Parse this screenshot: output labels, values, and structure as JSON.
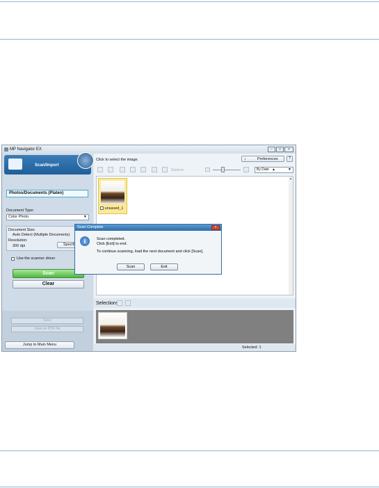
{
  "window": {
    "title": "MP Navigator EX"
  },
  "left_panel": {
    "banner_label": "Scan/Import",
    "mode": "Photos/Documents (Platen)",
    "document_type_label": "Document Type:",
    "document_type_value": "Color Photo",
    "document_size_label": "Document Size:",
    "document_size_value": "Auto Detect (Multiple Documents)",
    "resolution_label": "Resolution:",
    "resolution_value": "300 dpi",
    "specify_label": "Specify...",
    "scanner_driver_label": "Use the scanner driver",
    "scan_label": "Scan",
    "clear_label": "Clear",
    "save_label": "Save",
    "save_pdf_label": "Save as PDF file",
    "jump_label": "Jump to Main Menu"
  },
  "right_panel": {
    "hint": "Click to select the image.",
    "preferences_label": "Preferences",
    "help_label": "?",
    "zoom_label": "Zoom in",
    "sort_value": "By Date",
    "thumb_caption": "unsaved_1",
    "selections_label": "Selections",
    "status_text": "Selected: 1"
  },
  "dialog": {
    "title": "Scan Complete",
    "line1": "Scan completed.",
    "line2": "Click [Exit] to end.",
    "line3": "To continue scanning, load the next document and click [Scan].",
    "scan_button": "Scan",
    "exit_button": "Exit"
  }
}
